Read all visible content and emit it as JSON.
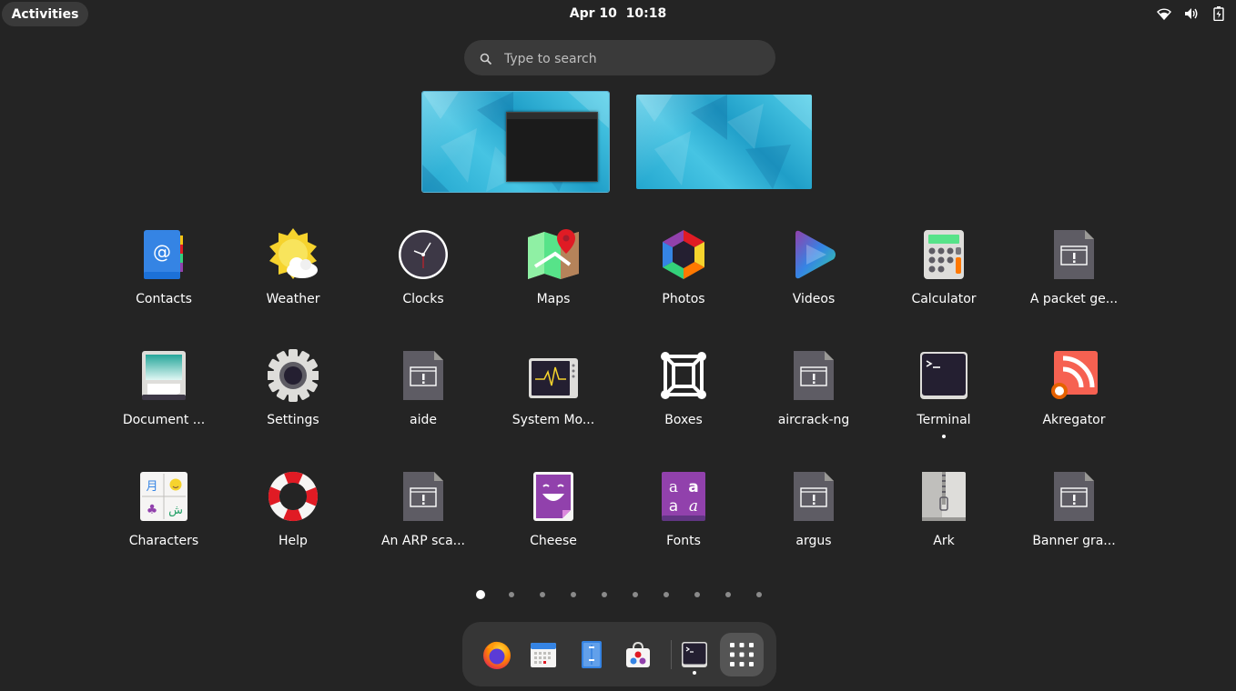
{
  "topbar": {
    "activities_label": "Activities",
    "datetime": "Apr 10  10:18",
    "tray_icons": [
      "wifi-icon",
      "volume-icon",
      "battery-icon"
    ]
  },
  "search": {
    "placeholder": "Type to search"
  },
  "apps": [
    {
      "label": "Contacts",
      "icon": "contacts-icon"
    },
    {
      "label": "Weather",
      "icon": "weather-icon"
    },
    {
      "label": "Clocks",
      "icon": "clocks-icon"
    },
    {
      "label": "Maps",
      "icon": "maps-icon"
    },
    {
      "label": "Photos",
      "icon": "photos-icon"
    },
    {
      "label": "Videos",
      "icon": "videos-icon"
    },
    {
      "label": "Calculator",
      "icon": "calculator-icon"
    },
    {
      "label": "A packet ge...",
      "icon": "generic-app-icon"
    },
    {
      "label": "Document ...",
      "icon": "document-scanner-icon"
    },
    {
      "label": "Settings",
      "icon": "settings-gear-icon"
    },
    {
      "label": "aide",
      "icon": "generic-app-icon"
    },
    {
      "label": "System Mo...",
      "icon": "system-monitor-icon"
    },
    {
      "label": "Boxes",
      "icon": "boxes-icon"
    },
    {
      "label": "aircrack-ng",
      "icon": "generic-app-icon"
    },
    {
      "label": "Terminal",
      "icon": "terminal-icon",
      "running": true
    },
    {
      "label": "Akregator",
      "icon": "rss-feed-icon"
    },
    {
      "label": "Characters",
      "icon": "characters-icon"
    },
    {
      "label": "Help",
      "icon": "help-lifebuoy-icon"
    },
    {
      "label": "An ARP sca...",
      "icon": "generic-app-icon"
    },
    {
      "label": "Cheese",
      "icon": "cheese-icon"
    },
    {
      "label": "Fonts",
      "icon": "fonts-icon"
    },
    {
      "label": "argus",
      "icon": "generic-app-icon"
    },
    {
      "label": "Ark",
      "icon": "archive-zipper-icon"
    },
    {
      "label": "Banner gra...",
      "icon": "generic-app-icon"
    }
  ],
  "pages": {
    "count": 10,
    "current": 1
  },
  "dock": [
    "firefox-icon",
    "calendar-icon",
    "files-icon",
    "software-store-icon",
    "terminal-icon",
    "show-apps-grid-icon"
  ]
}
